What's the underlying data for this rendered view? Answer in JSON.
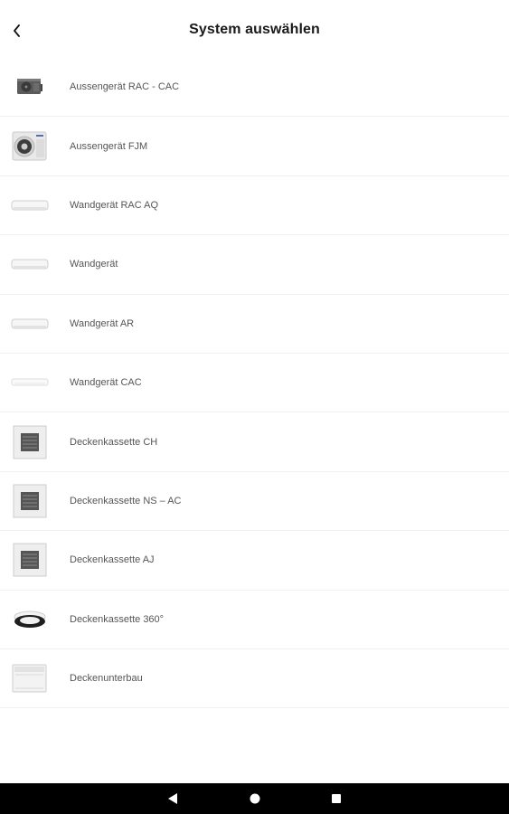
{
  "header": {
    "title": "System auswählen",
    "back_icon": "chevron-left-icon"
  },
  "systems": [
    {
      "label": "Aussengerät RAC - CAC",
      "icon": "outdoor-unit-small-icon"
    },
    {
      "label": "Aussengerät FJM",
      "icon": "outdoor-unit-fan-icon"
    },
    {
      "label": "Wandgerät RAC AQ",
      "icon": "wall-unit-icon"
    },
    {
      "label": "Wandgerät",
      "icon": "wall-unit-icon"
    },
    {
      "label": "Wandgerät AR",
      "icon": "wall-unit-icon"
    },
    {
      "label": "Wandgerät CAC",
      "icon": "wall-unit-slim-icon"
    },
    {
      "label": "Deckenkassette CH",
      "icon": "ceiling-cassette-icon"
    },
    {
      "label": "Deckenkassette NS – AC",
      "icon": "ceiling-cassette-icon"
    },
    {
      "label": "Deckenkassette AJ",
      "icon": "ceiling-cassette-icon"
    },
    {
      "label": "Deckenkassette 360°",
      "icon": "round-cassette-icon"
    },
    {
      "label": "Deckenunterbau",
      "icon": "floor-ceiling-unit-icon"
    }
  ],
  "navbar": {
    "back_icon": "triangle-back-icon",
    "home_icon": "circle-home-icon",
    "recent_icon": "square-recent-icon"
  },
  "colors": {
    "background": "#ffffff",
    "divider": "#f0f0f0",
    "title": "#1a1a1a",
    "label": "#555555",
    "navbar": "#000000"
  }
}
